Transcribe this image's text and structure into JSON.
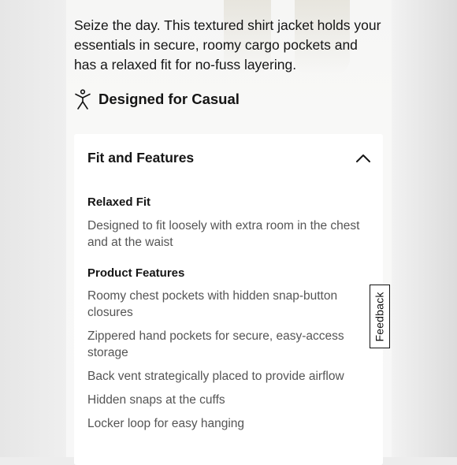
{
  "product": {
    "description": "Seize the day. This textured shirt jacket holds your essentials in secure, roomy cargo pockets and has a relaxed fit for no-fuss layering.",
    "designed_for": {
      "icon": "person-activity-icon",
      "label": "Designed for Casual"
    }
  },
  "fit_features": {
    "title": "Fit and Features",
    "expanded": true,
    "toggle_icon": "chevron-up-icon",
    "fit": {
      "heading": "Relaxed Fit",
      "text": "Designed to fit loosely with extra room in the chest and at the waist"
    },
    "features": {
      "heading": "Product Features",
      "items": [
        "Roomy chest pockets with hidden snap-button closures",
        "Zippered hand pockets for secure, easy-access storage",
        "Back vent strategically placed to provide airflow",
        "Hidden snaps at the cuffs",
        "Locker loop for easy hanging"
      ]
    }
  },
  "feedback": {
    "label": "Feedback"
  }
}
